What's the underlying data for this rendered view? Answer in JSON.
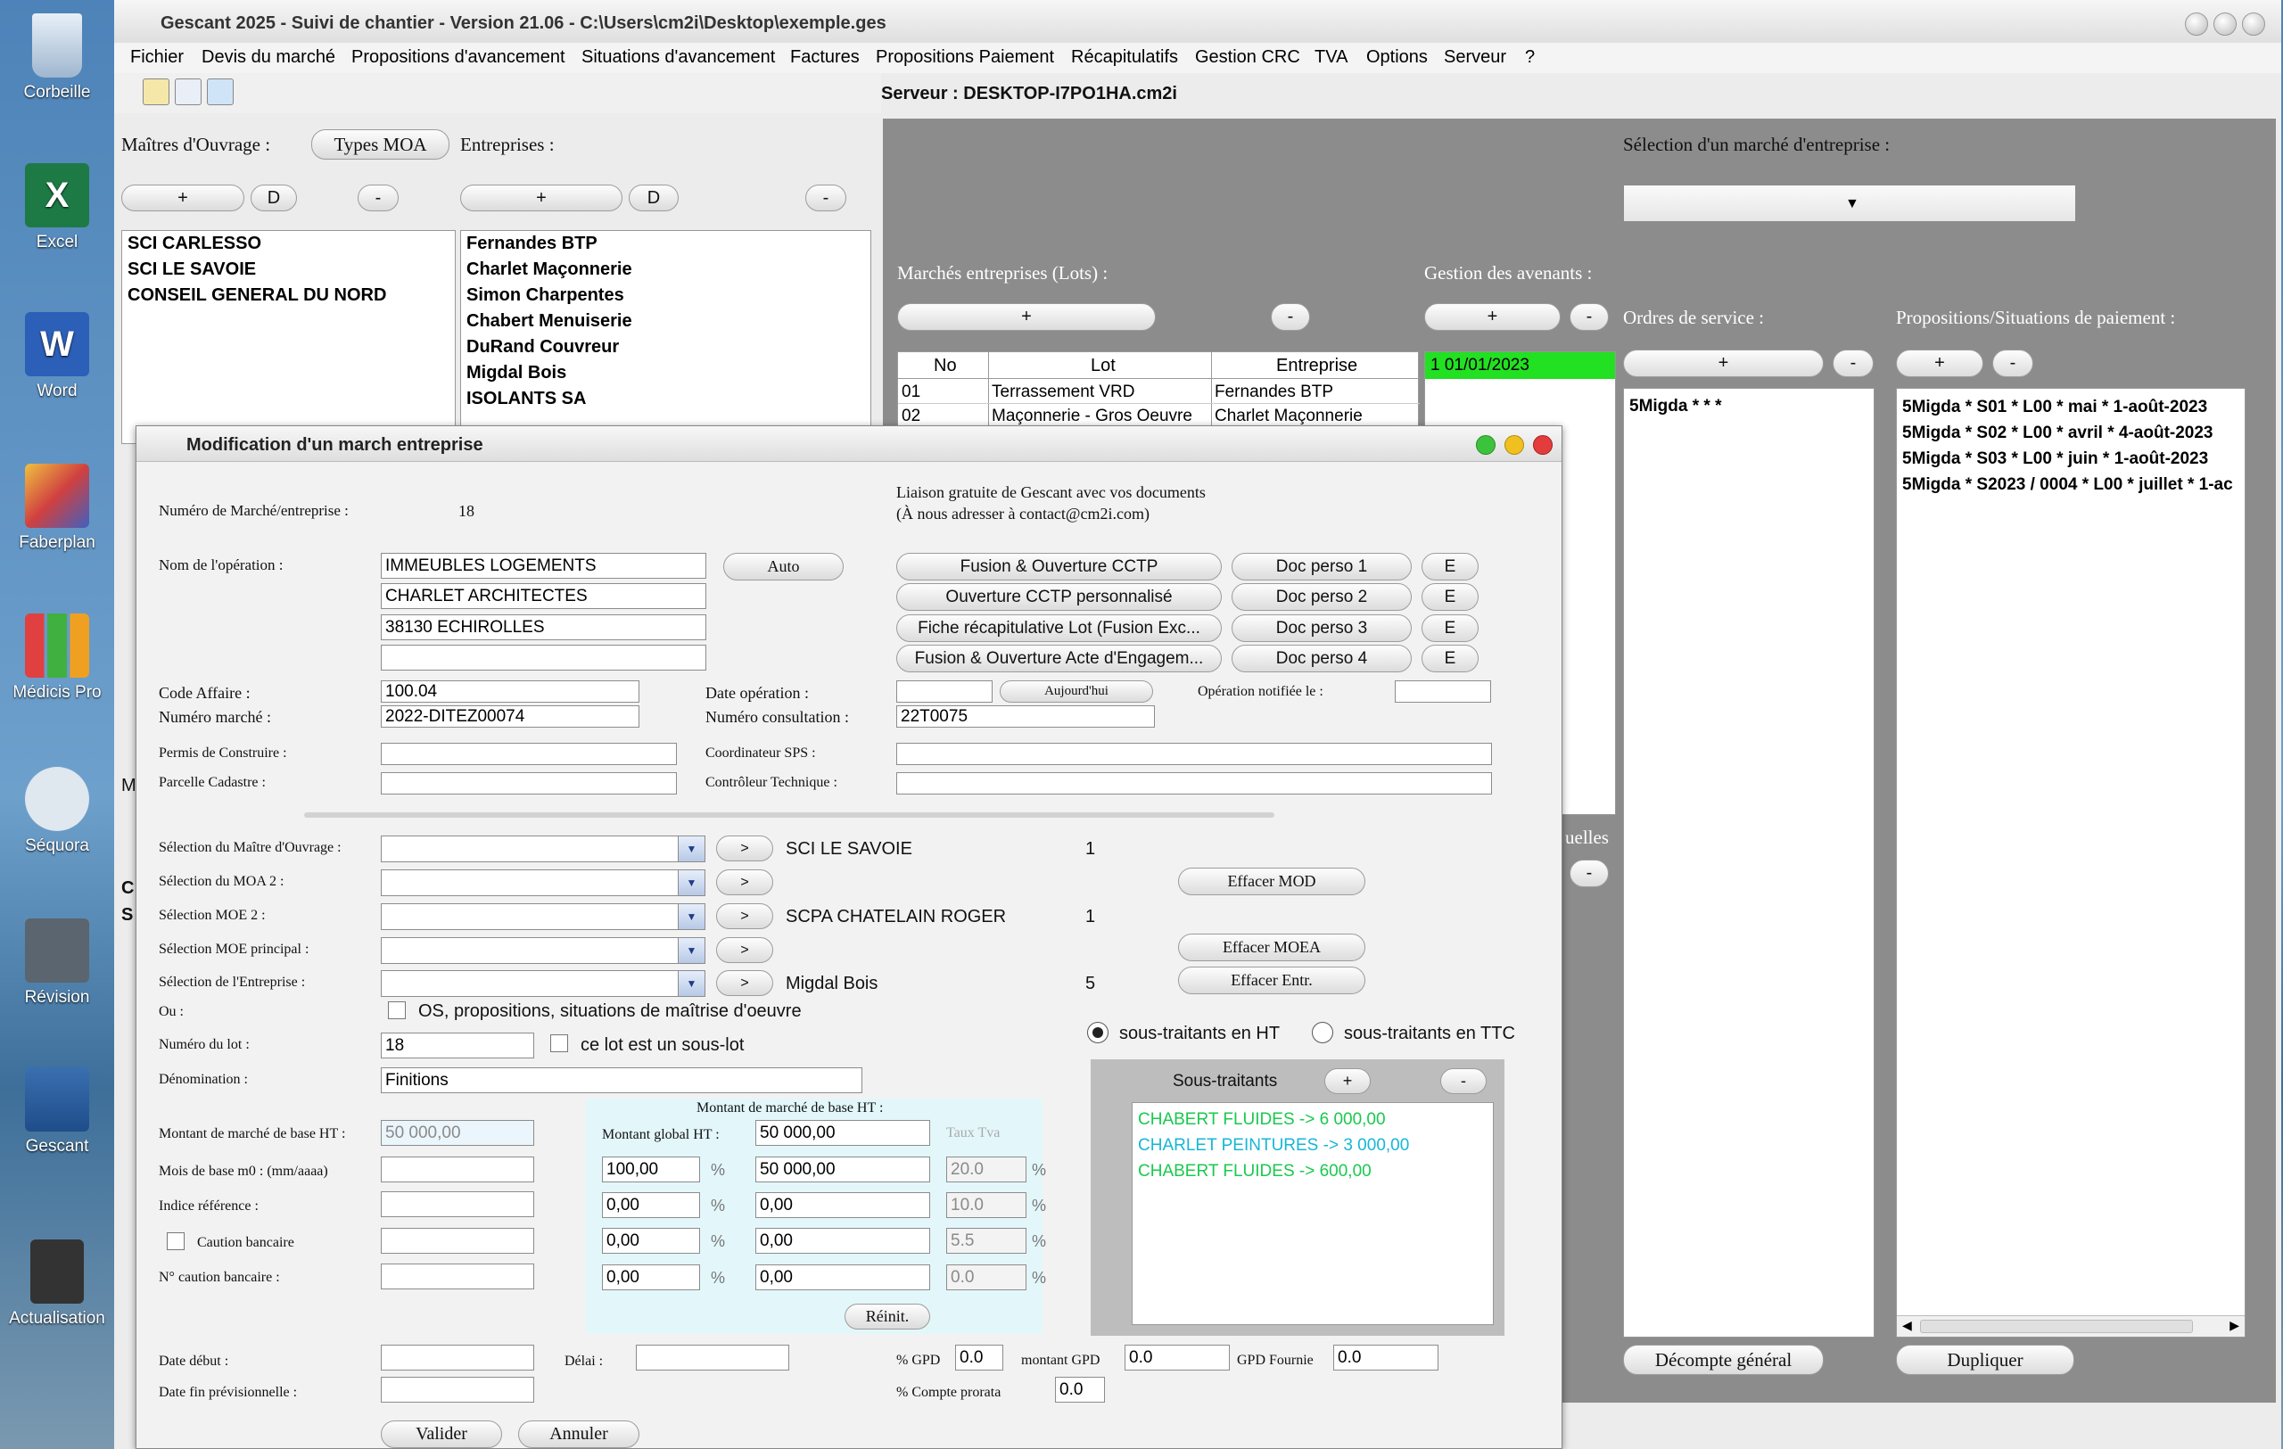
{
  "desktop": {
    "icons": [
      "Corbeille",
      "Excel",
      "Word",
      "Faberplan",
      "Médicis Pro",
      "Séquora",
      "Révision",
      "Gescant",
      "Actualisation"
    ]
  },
  "window": {
    "title": "Gescant 2025 - Suivi de chantier - Version 21.06 - C:\\Users\\cm2i\\Desktop\\exemple.ges"
  },
  "menu": [
    "Fichier",
    "Devis du marché",
    "Propositions d'avancement",
    "Situations d'avancement",
    "Factures",
    "Propositions Paiement",
    "Récapitulatifs",
    "Gestion CRC",
    "TVA",
    "Options",
    "Serveur",
    "?"
  ],
  "server_label": "Serveur : DESKTOP-I7PO1HA.cm2i",
  "left_panel": {
    "moa_label": "Maîtres d'Ouvrage :",
    "types_moa": "Types MOA",
    "entreprises_label": "Entreprises :",
    "btn_plus": "+",
    "btn_d": "D",
    "btn_minus": "-",
    "moa_list": [
      "SCI CARLESSO",
      "SCI LE SAVOIE",
      "CONSEIL GENERAL DU NORD"
    ],
    "entreprises_list": [
      "Fernandes BTP",
      "Charlet Maçonnerie",
      "Simon Charpentes",
      "Chabert Menuiserie",
      "DuRand Couvreur",
      "Migdal Bois",
      "ISOLANTS SA"
    ]
  },
  "right_panel": {
    "selection_label": "Sélection d'un marché d'entreprise :",
    "marches_label": "Marchés entreprises (Lots) :",
    "avenants_label": "Gestion des avenants :",
    "ordres_label": "Ordres de service :",
    "propositions_label": "Propositions/Situations de paiement :",
    "table_headers": [
      "No",
      "Lot",
      "Entreprise"
    ],
    "table_rows": [
      [
        "01",
        "Terrassement VRD",
        "Fernandes BTP"
      ],
      [
        "02",
        "Maçonnerie - Gros Oeuvre",
        "Charlet Maçonnerie"
      ]
    ],
    "avenant_item": "1 01/01/2023",
    "ordre_item": "5Migda *  *  *",
    "propositions": [
      "5Migda * S01 * L00 * mai * 1-août-2023",
      "5Migda * S02 * L00 * avril * 4-août-2023",
      "5Migda * S03 * L00 * juin * 1-août-2023",
      "5Migda * S2023 / 0004 * L00 * juillet * 1-ac"
    ],
    "partial_label": "uelles",
    "decompte": "Décompte général",
    "dupliquer": "Dupliquer",
    "left_fragments": [
      "M",
      "C",
      "S"
    ]
  },
  "dialog": {
    "title": "Modification d'un march  entreprise",
    "numero_label": "Numéro de Marché/entreprise :",
    "numero_value": "18",
    "liaison_line1": "Liaison gratuite de Gescant avec vos documents",
    "liaison_line2": "(À nous adresser à contact@cm2i.com)",
    "nom_operation_label": "Nom de l'opération :",
    "operation_lines": [
      "IMMEUBLES LOGEMENTS",
      "CHARLET ARCHITECTES",
      "38130 ECHIROLLES",
      ""
    ],
    "auto": "Auto",
    "doc_buttons": [
      "Fusion & Ouverture CCTP",
      "Ouverture CCTP personnalisé",
      "Fiche récapitulative Lot (Fusion Exc...",
      "Fusion & Ouverture Acte d'Engagem..."
    ],
    "doc_perso": [
      "Doc perso 1",
      "Doc perso 2",
      "Doc perso 3",
      "Doc perso 4"
    ],
    "e_label": "E",
    "code_affaire_label": "Code Affaire  :",
    "code_affaire": "100.04",
    "numero_marche_label": "Numéro marché :",
    "numero_marche": "2022-DITEZ00074",
    "date_operation_label": "Date opération :",
    "aujourdhui": "Aujourd'hui",
    "operation_notifiee_label": "Opération notifiée le :",
    "numero_consultation_label": "Numéro consultation :",
    "numero_consultation": "22T0075",
    "permis_label": "Permis de Construire :",
    "parcelle_label": "Parcelle Cadastre :",
    "coordinateur_label": "Coordinateur SPS :",
    "controleur_label": "Contrôleur Technique :",
    "sel_moa_label": "Sélection du Maître d'Ouvrage :",
    "sel_moa2_label": "Sélection du MOA 2 :",
    "sel_moe2_label": "Sélection MOE 2 :",
    "sel_moe_principal_label": "Sélection MOE principal :",
    "sel_entreprise_label": "Sélection de l'Entreprise :",
    "arrow": ">",
    "moa_value": "SCI LE SAVOIE",
    "moa_num": "1",
    "moe2_value": "SCPA CHATELAIN ROGER",
    "moe2_num": "1",
    "entreprise_value": "Migdal Bois",
    "entreprise_num": "5",
    "effacer_mod": "Effacer MOD",
    "effacer_moea": "Effacer MOEA",
    "effacer_entr": "Effacer Entr.",
    "ou_label": "Ou :",
    "os_label": "OS, propositions, situations de maîtrise d'oeuvre",
    "numero_lot_label": "Numéro du lot :",
    "numero_lot": "18",
    "sous_lot_label": "ce lot est un sous-lot",
    "denomination_label": "Dénomination :",
    "denomination": "Finitions",
    "st_ht": "sous-traitants en HT",
    "st_ttc": "sous-traitants en TTC",
    "montant_base_label": "Montant de marché de base HT :",
    "montant_base_value": "50 000,00",
    "mois_base_label": "Mois de base m0 : (mm/aaaa)",
    "indice_label": "Indice référence :",
    "caution_label": "Caution bancaire",
    "no_caution_label": "N° caution bancaire :",
    "montant_box_title": "Montant de marché de base HT :",
    "montant_global_label": "Montant global HT :",
    "montant_global": "50 000,00",
    "taux_tva_label": "Taux Tva",
    "pct_sign": "%",
    "montant_rows": [
      {
        "pct": "100,00",
        "amount": "50 000,00",
        "tva": "20.0"
      },
      {
        "pct": "0,00",
        "amount": "0,00",
        "tva": "10.0"
      },
      {
        "pct": "0,00",
        "amount": "0,00",
        "tva": "5.5"
      },
      {
        "pct": "0,00",
        "amount": "0,00",
        "tva": "0.0"
      }
    ],
    "reinit": "Réinit.",
    "sous_traitants_title": "Sous-traitants",
    "st_plus": "+",
    "st_minus": "-",
    "sous_traitants": [
      "CHABERT FLUIDES -> 6 000,00",
      "CHARLET PEINTURES -> 3 000,00",
      "CHABERT FLUIDES -> 600,00"
    ],
    "date_debut_label": "Date début :",
    "delai_label": "Délai :",
    "date_fin_label": "Date fin prévisionnelle :",
    "gpd_label": "% GPD",
    "gpd_value": "0.0",
    "montant_gpd_label": "montant GPD",
    "montant_gpd": "0.0",
    "gpd_fournie_label": "GPD Fournie",
    "gpd_fournie": "0.0",
    "compte_prorata_label": "% Compte prorata",
    "compte_prorata": "0.0",
    "valider": "Valider",
    "annuler": "Annuler"
  },
  "colors": {
    "avenant_highlight": "#22e022",
    "st_green": "#19c94e",
    "st_cyan": "#16b6d6",
    "panel_gray": "#8c8c8c",
    "montant_box": "#e3f7fb"
  }
}
